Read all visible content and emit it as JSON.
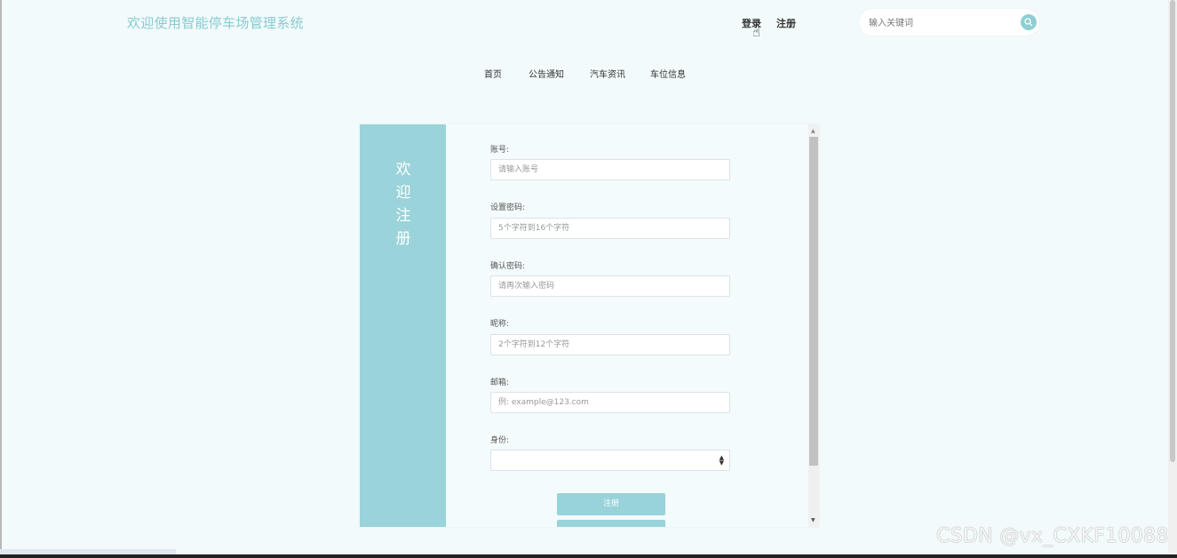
{
  "header": {
    "site_title": "欢迎使用智能停车场管理系统",
    "login_label": "登录",
    "register_label": "注册",
    "search_placeholder": "输入关键词"
  },
  "nav": {
    "items": [
      {
        "label": "首页"
      },
      {
        "label": "公告通知"
      },
      {
        "label": "汽车资讯"
      },
      {
        "label": "车位信息"
      }
    ]
  },
  "register_form": {
    "banner_text": "欢迎注册",
    "fields": [
      {
        "label": "账号:",
        "placeholder": "请输入账号"
      },
      {
        "label": "设置密码:",
        "placeholder": "5个字符到16个字符"
      },
      {
        "label": "确认密码:",
        "placeholder": "请再次输入密码"
      },
      {
        "label": "昵称:",
        "placeholder": "2个字符到12个字符"
      },
      {
        "label": "邮箱:",
        "placeholder": "例: example@123.com"
      }
    ],
    "role": {
      "label": "身份:",
      "selected": ""
    },
    "submit_label": "注册"
  },
  "watermark": "CSDN @vx_CXKF10088",
  "colors": {
    "accent": "#98d3da",
    "page_background": "#f2fafb",
    "title_color": "#88cbd0"
  }
}
